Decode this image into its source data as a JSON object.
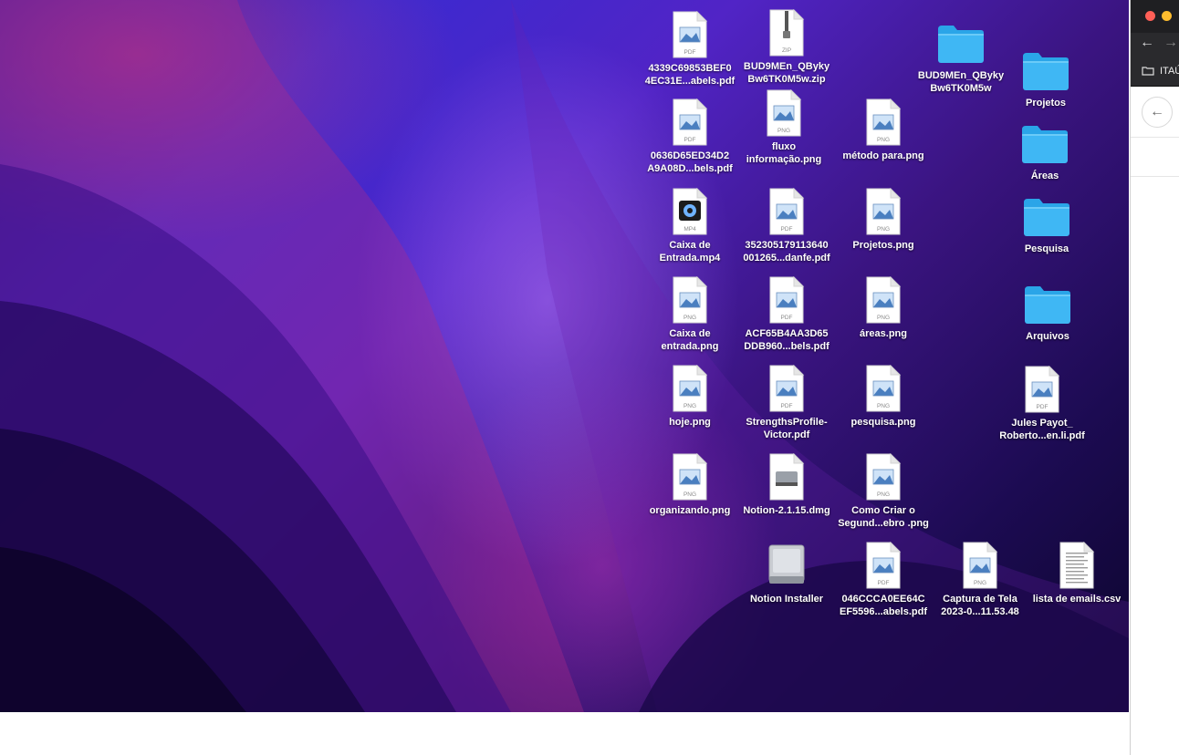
{
  "desktop": {
    "icons": [
      {
        "label": "4339C69853BEF0\n4EC31E...abels.pdf",
        "type": "pdf"
      },
      {
        "label": "BUD9MEn_QByky\nBw6TK0M5w.zip",
        "type": "zip"
      },
      {
        "label": "BUD9MEn_QByky\nBw6TK0M5w",
        "type": "folder"
      },
      {
        "label": "Projetos",
        "type": "folder"
      },
      {
        "label": "0636D65ED34D2\nA9A08D...bels.pdf",
        "type": "pdf"
      },
      {
        "label": "fluxo\ninformação.png",
        "type": "png"
      },
      {
        "label": "método para.png",
        "type": "png"
      },
      {
        "label": "Áreas",
        "type": "folder"
      },
      {
        "label": "Caixa de\nEntrada.mp4",
        "type": "mp4"
      },
      {
        "label": "352305179113640\n001265...danfe.pdf",
        "type": "pdf"
      },
      {
        "label": "Projetos.png",
        "type": "png"
      },
      {
        "label": "Pesquisa",
        "type": "folder"
      },
      {
        "label": "Caixa de\nentrada.png",
        "type": "png"
      },
      {
        "label": "ACF65B4AA3D65\nDDB960...bels.pdf",
        "type": "pdf"
      },
      {
        "label": "áreas.png",
        "type": "png"
      },
      {
        "label": "Arquivos",
        "type": "folder"
      },
      {
        "label": "hoje.png",
        "type": "png"
      },
      {
        "label": "StrengthsProfile-\nVictor.pdf",
        "type": "pdf"
      },
      {
        "label": "pesquisa.png",
        "type": "png"
      },
      {
        "label": "Jules Payot_\nRoberto...en.li.pdf",
        "type": "pdf"
      },
      {
        "label": "organizando.png",
        "type": "png"
      },
      {
        "label": "Notion-2.1.15.dmg",
        "type": "dmg"
      },
      {
        "label": "Como Criar o\nSegund...ebro .png",
        "type": "png"
      },
      {
        "label": "Notion Installer",
        "type": "disk"
      },
      {
        "label": "046CCCA0EE64C\nEF5596...abels.pdf",
        "type": "pdf"
      },
      {
        "label": "Captura de Tela\n2023-0...11.53.48",
        "type": "png"
      },
      {
        "label": "lista de emails.csv",
        "type": "csv"
      }
    ]
  },
  "browser": {
    "bookmark_label": "ITAÚ",
    "back_glyph": "←",
    "forward_glyph": "→",
    "page_back_glyph": "←"
  },
  "file_badges": {
    "pdf": "PDF",
    "png": "PNG",
    "zip": "ZIP",
    "mp4": "MP4"
  },
  "colors": {
    "folder": "#3fb7f4",
    "folder_tab": "#2aa5e8",
    "traffic_red": "#ff5f57",
    "traffic_yellow": "#febc2e"
  }
}
